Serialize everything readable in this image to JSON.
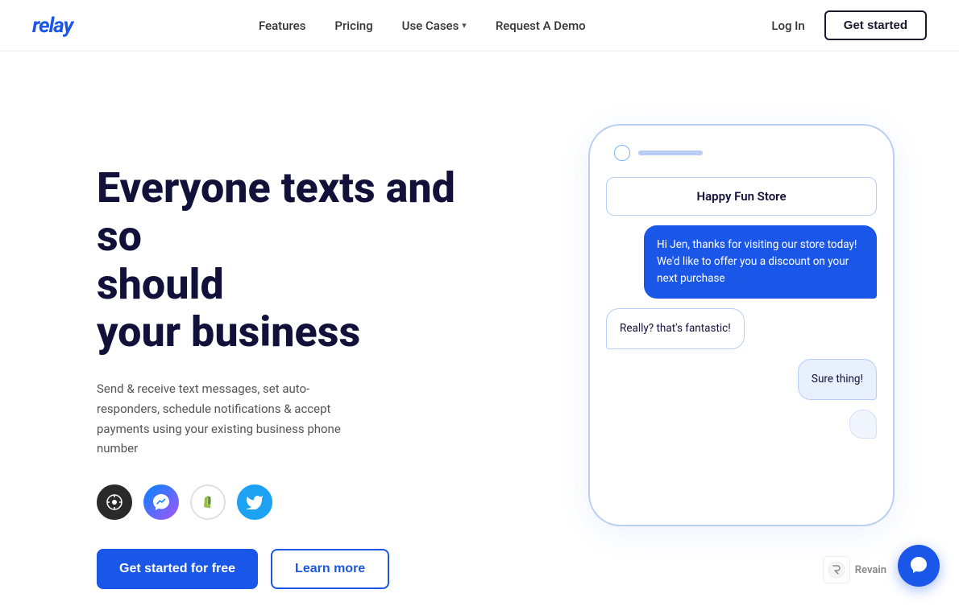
{
  "nav": {
    "logo": "relay",
    "links": [
      {
        "label": "Features",
        "id": "features"
      },
      {
        "label": "Pricing",
        "id": "pricing"
      },
      {
        "label": "Use Cases",
        "id": "use-cases",
        "hasChevron": true
      },
      {
        "label": "Request A Demo",
        "id": "demo"
      }
    ],
    "login_label": "Log In",
    "cta_label": "Get started"
  },
  "hero": {
    "title_line1": "Everyone texts and so",
    "title_line2": "should",
    "title_line3": "your business",
    "subtitle": "Send & receive text messages, set auto-responders, schedule notifications & accept payments using your existing business phone number",
    "cta_primary": "Get started for free",
    "cta_secondary": "Learn more"
  },
  "integrations": [
    {
      "id": "hub",
      "symbol": "⊙",
      "style": "dark"
    },
    {
      "id": "messenger",
      "symbol": "💬",
      "style": "blue-messenger"
    },
    {
      "id": "shopify",
      "symbol": "🛍",
      "style": "shopify"
    },
    {
      "id": "twitter",
      "symbol": "🐦",
      "style": "twitter"
    }
  ],
  "phone_mockup": {
    "store_name": "Happy Fun Store",
    "messages": [
      {
        "type": "right",
        "text": "Hi Jen, thanks for visiting our store today! We'd like to offer you a discount on your next purchase"
      },
      {
        "type": "left",
        "text": "Really? that's fantastic!"
      },
      {
        "type": "right-light",
        "text": "Sure thing!"
      },
      {
        "type": "partial",
        "text": "..."
      }
    ]
  },
  "chat_widget": {
    "icon": "💬"
  },
  "revain": {
    "label": "Revain"
  }
}
